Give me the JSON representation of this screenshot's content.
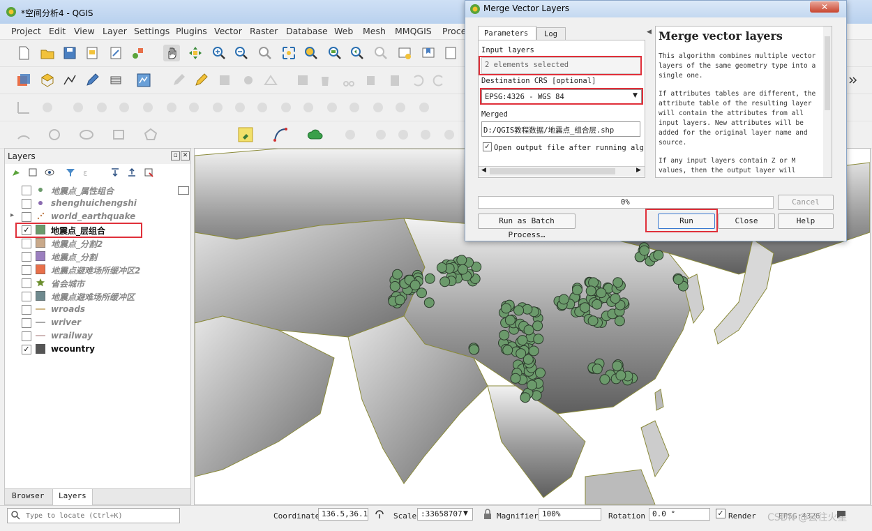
{
  "app": {
    "title": "*空间分析4 - QGIS"
  },
  "menu": [
    "Project",
    "Edit",
    "View",
    "Layer",
    "Settings",
    "Plugins",
    "Vector",
    "Raster",
    "Database",
    "Web",
    "Mesh",
    "MMQGIS",
    "Proce"
  ],
  "layers_panel": {
    "title": "Layers",
    "layers": [
      {
        "name": "地震点_属性组合",
        "checked": false,
        "symbol": "point",
        "color": "#6b9a6b"
      },
      {
        "name": "shenghuichengshi",
        "checked": false,
        "symbol": "point",
        "color": "#8a6ab0"
      },
      {
        "name": "world_earthquake",
        "checked": false,
        "symbol": "dots",
        "color": "#c08050"
      },
      {
        "name": "地震点_层组合",
        "checked": true,
        "symbol": "fill",
        "color": "#6b9a6b"
      },
      {
        "name": "地震点_分割2",
        "checked": false,
        "symbol": "fill",
        "color": "#c9a98a"
      },
      {
        "name": "地震点_分割",
        "checked": false,
        "symbol": "fill",
        "color": "#9b7fbf"
      },
      {
        "name": "地震点避难场所缓冲区2",
        "checked": false,
        "symbol": "fill",
        "color": "#e8704a"
      },
      {
        "name": "省会城市",
        "checked": false,
        "symbol": "star",
        "color": "#6b8e2e"
      },
      {
        "name": "地震点避难场所缓冲区",
        "checked": false,
        "symbol": "fill",
        "color": "#6f8a8f"
      },
      {
        "name": "wroads",
        "checked": false,
        "symbol": "line",
        "color": "#c0a060"
      },
      {
        "name": "wriver",
        "checked": false,
        "symbol": "line",
        "color": "#8c8c8c"
      },
      {
        "name": "wrailway",
        "checked": false,
        "symbol": "line",
        "color": "#c0a0a0"
      },
      {
        "name": "wcountry",
        "checked": true,
        "symbol": "fill",
        "color": "#555555"
      }
    ],
    "tabs": [
      "Browser",
      "Layers"
    ]
  },
  "statusbar": {
    "locate_placeholder": "Type to locate (Ctrl+K)",
    "coordinate_label": "Coordinate",
    "coordinate_value": "136.5,36.1",
    "scale_label": "Scale",
    "scale_value": ":33658707",
    "magnifier_label": "Magnifier",
    "magnifier_value": "100%",
    "rotation_label": "Rotation",
    "rotation_value": "0.0 °",
    "render_label": "Render",
    "crs_label": "EPSG:4326",
    "watermark": "CSDN @云往火星"
  },
  "dialog": {
    "title": "Merge Vector Layers",
    "tabs": [
      "Parameters",
      "Log"
    ],
    "input_layers_label": "Input layers",
    "input_layers_value": "2 elements selected",
    "dest_crs_label": "Destination CRS [optional]",
    "dest_crs_value": "EPSG:4326 - WGS 84",
    "merged_label": "Merged",
    "merged_value": "D:/QGIS教程数据/地震点_组合层.shp",
    "open_output_label": "Open output file after running algorithm",
    "progress": "0%",
    "cancel": "Cancel",
    "batch": "Run as Batch Process…",
    "run": "Run",
    "close": "Close",
    "help": "Help",
    "help_title": "Merge vector layers",
    "help_p1": "This algorithm combines multiple vector layers of the same geometry type into a single one.",
    "help_p2": "If attributes tables are different, the attribute table of the resulting layer will contain the attributes from all input layers. New attributes will be added for the original layer name and source.",
    "help_p3": "If any input layers contain Z or M values, then the output layer will"
  },
  "colors": {
    "accent_red": "#e0303a",
    "point_fill": "#6b9a6b"
  }
}
